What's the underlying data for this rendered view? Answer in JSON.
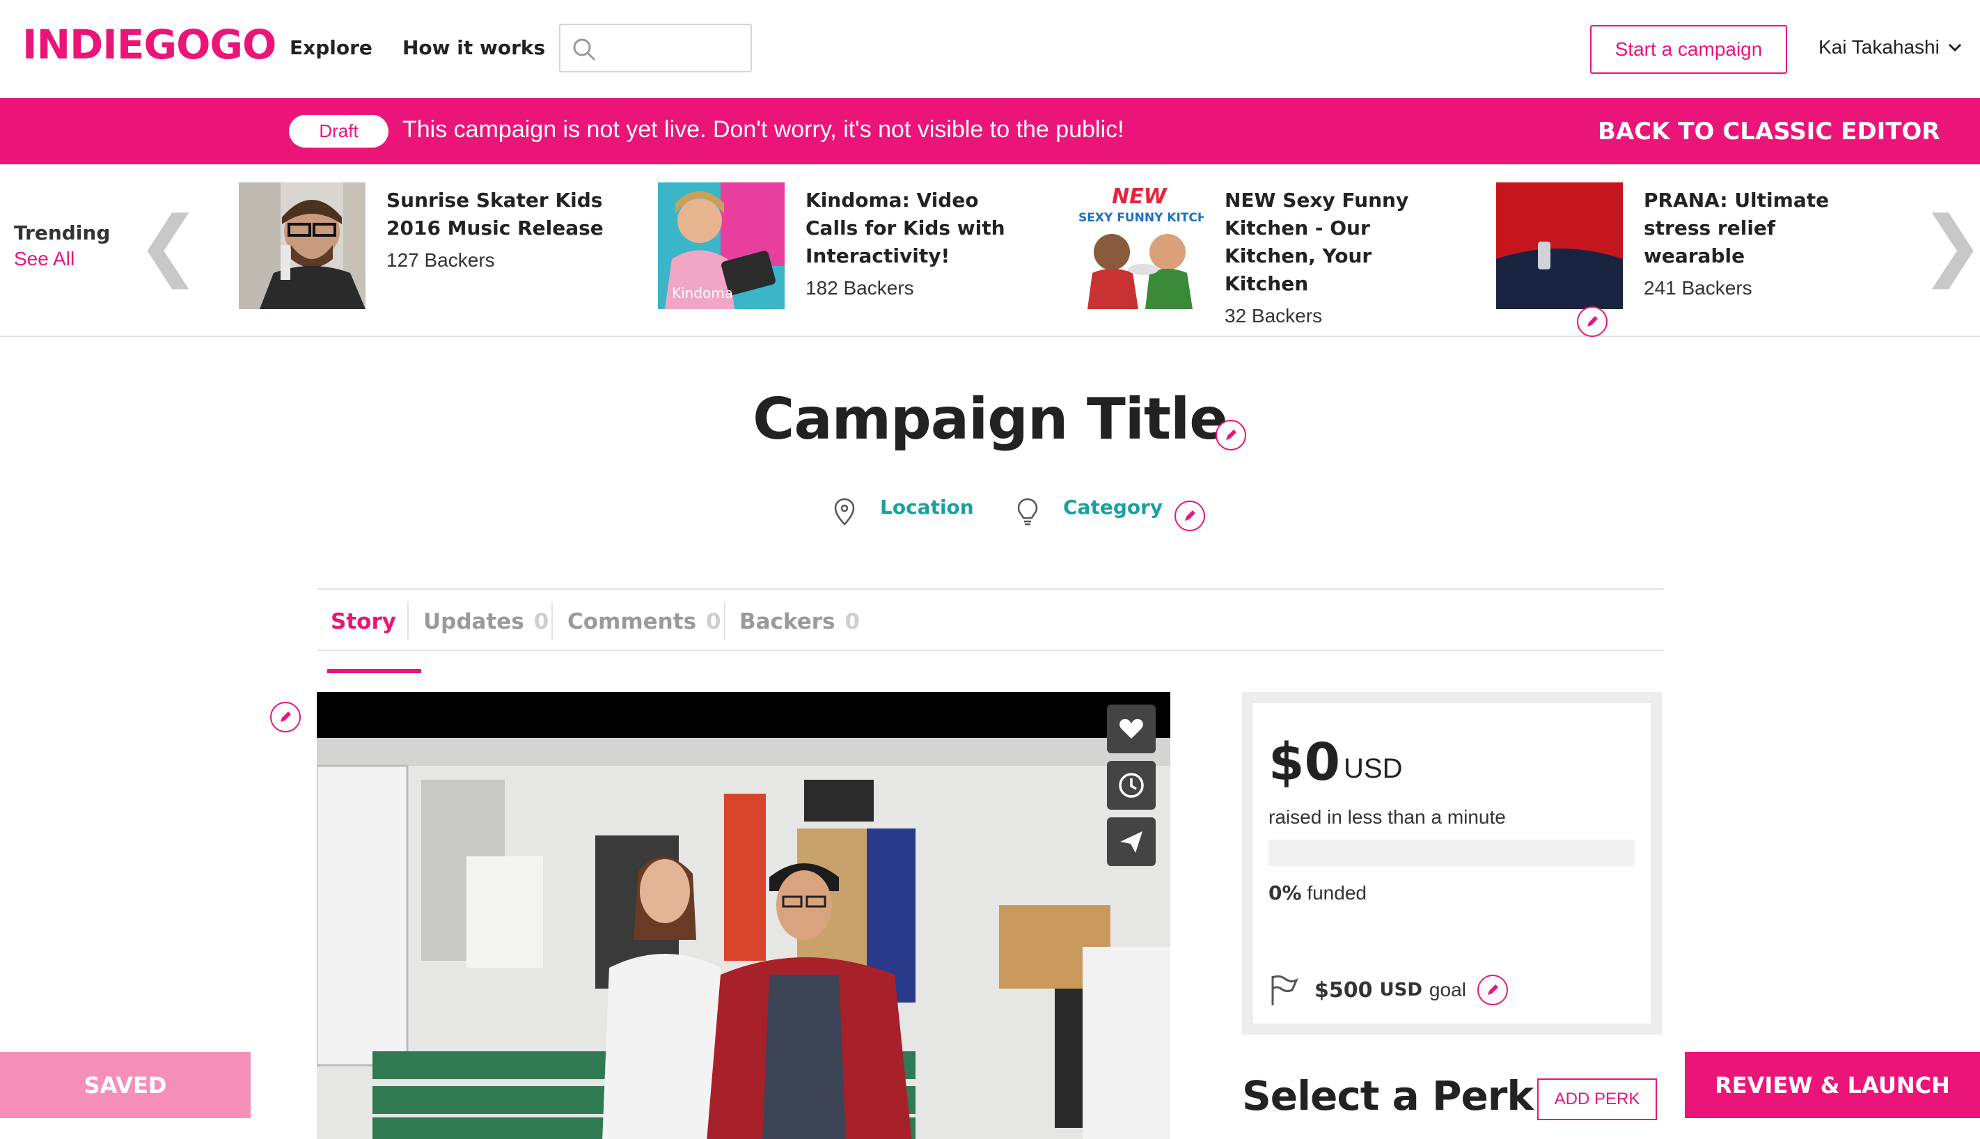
{
  "header": {
    "logo": "INDIEGOGO",
    "nav": {
      "explore": "Explore",
      "how_it_works": "How it works"
    },
    "search": {
      "placeholder": ""
    },
    "start_campaign": "Start a campaign",
    "user_name": "Kai Takahashi"
  },
  "banner": {
    "draft_label": "Draft",
    "message": "This campaign is not yet live. Don't worry, it's not visible to the public!",
    "classic_editor": "BACK TO CLASSIC EDITOR"
  },
  "trending": {
    "title": "Trending",
    "see_all": "See All",
    "items": [
      {
        "title": "Sunrise Skater Kids 2016 Music Release",
        "backers": "127 Backers"
      },
      {
        "title": "Kindoma: Video Calls for Kids with Interactivity!",
        "backers": "182 Backers"
      },
      {
        "title": "NEW Sexy Funny Kitchen - Our Kitchen, Your Kitchen",
        "backers": "32 Backers"
      },
      {
        "title": "PRANA: Ultimate stress relief wearable",
        "backers": "241 Backers"
      }
    ],
    "thumb_text": {
      "kindoma_caption": "Kindoma",
      "kitchen_new": "NEW",
      "kitchen_brand": "SEXY FUNNY KITCHEN"
    }
  },
  "campaign": {
    "title": "Campaign Title",
    "location": "Location",
    "category": "Category"
  },
  "tabs": [
    {
      "label": "Story",
      "count": ""
    },
    {
      "label": "Updates",
      "count": "0"
    },
    {
      "label": "Comments",
      "count": "0"
    },
    {
      "label": "Backers",
      "count": "0"
    }
  ],
  "funding": {
    "amount": "$0",
    "currency": "USD",
    "raised_text": "raised in less than a minute",
    "percent": "0%",
    "funded_word": "funded",
    "progress_fraction": 0,
    "goal_amount": "$500",
    "goal_currency": "USD",
    "goal_word": "goal"
  },
  "perks": {
    "title": "Select a Perk",
    "add_button": "ADD PERK"
  },
  "footer_buttons": {
    "saved": "SAVED",
    "review_launch": "REVIEW & LAUNCH"
  },
  "colors": {
    "brand": "#eb1478",
    "teal": "#1aa0a3",
    "saved_pink": "#f58fb8"
  }
}
